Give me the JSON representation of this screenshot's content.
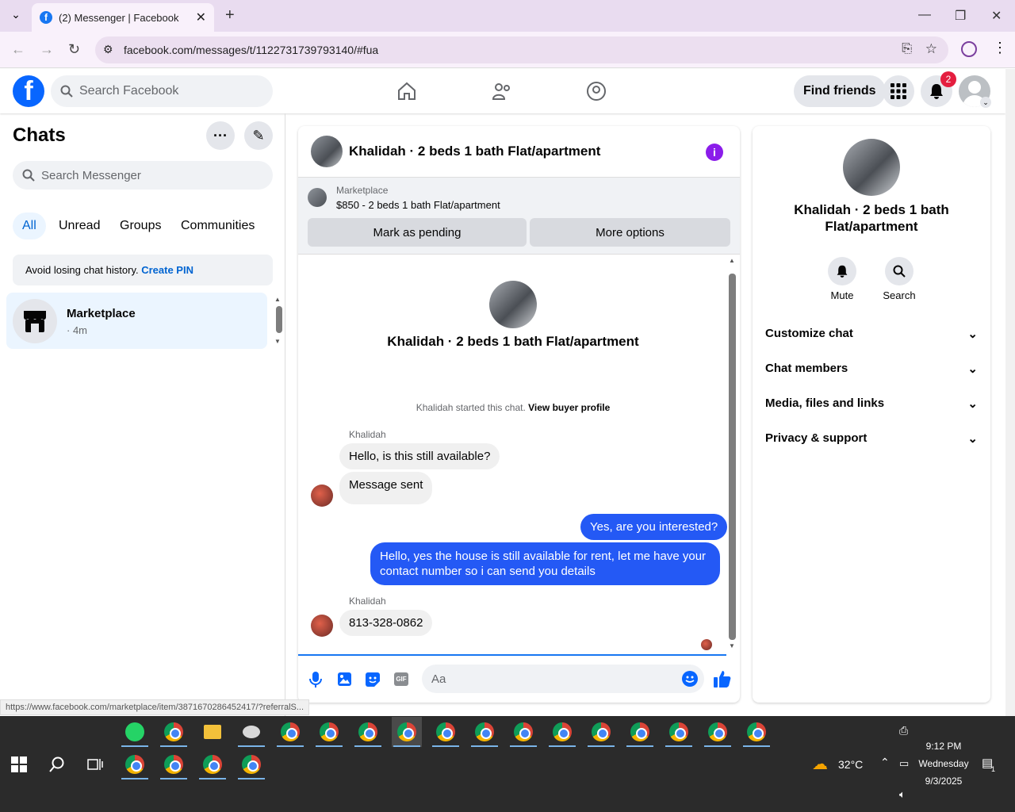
{
  "browser": {
    "tab_title": "(2) Messenger | Facebook",
    "url": "facebook.com/messages/t/1122731739793140/#fua",
    "status_url": "https://www.facebook.com/marketplace/item/3871670286452417/?referralS..."
  },
  "header": {
    "search_placeholder": "Search Facebook",
    "find_friends": "Find friends",
    "notification_count": "2"
  },
  "chats": {
    "title": "Chats",
    "search_placeholder": "Search Messenger",
    "filters": [
      "All",
      "Unread",
      "Groups",
      "Communities"
    ],
    "pin_text": "Avoid losing chat history.",
    "pin_link": "Create PIN",
    "items": [
      {
        "name": "Marketplace",
        "time": "· 4m"
      }
    ]
  },
  "conversation": {
    "title": "Khalidah · 2 beds 1 bath Flat/apartment",
    "marketplace_label": "Marketplace",
    "listing": "$850 - 2 beds 1 bath Flat/apartment",
    "mark_pending": "Mark as pending",
    "more_options": "More options",
    "intro_name": "Khalidah · 2 beds 1 bath Flat/apartment",
    "started_text": "Khalidah started this chat.",
    "view_profile": "View buyer profile",
    "sender1": "Khalidah",
    "msg1": "Hello, is this still available?",
    "msg2": "Message sent",
    "out1": "Yes, are you interested?",
    "out2": "Hello, yes the house is still available for rent, let me have your contact number so i can send you details",
    "sender2": "Khalidah",
    "msg3": "813-328-0862",
    "composer_placeholder": "Aa"
  },
  "details": {
    "name": "Khalidah · 2 beds 1 bath Flat/apartment",
    "mute": "Mute",
    "search": "Search",
    "sections": [
      "Customize chat",
      "Chat members",
      "Media, files and links",
      "Privacy & support"
    ]
  },
  "taskbar": {
    "temperature": "32°C",
    "time": "9:12 PM",
    "day": "Wednesday",
    "date": "9/3/2025",
    "notif_count": "1"
  }
}
